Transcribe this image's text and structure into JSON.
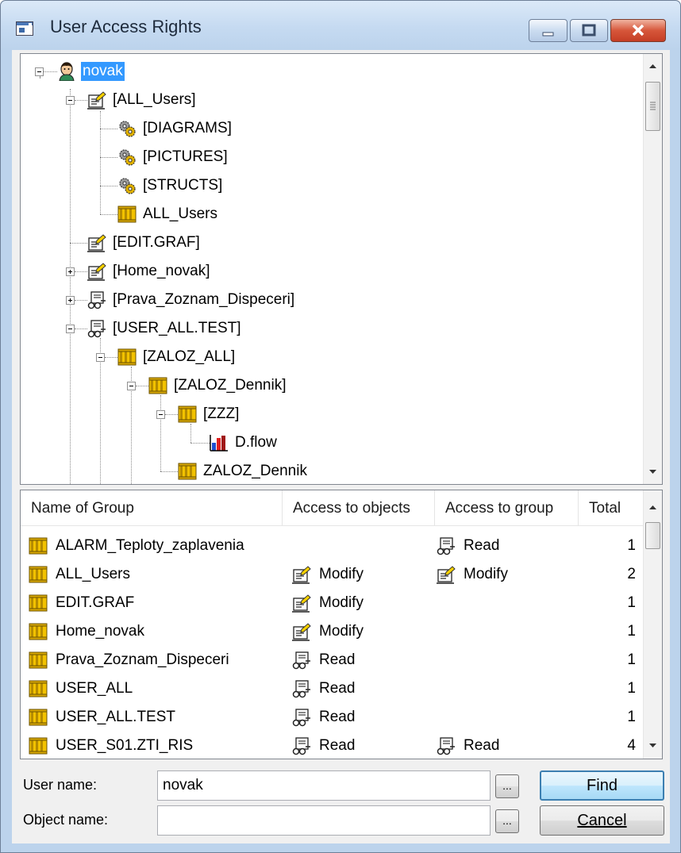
{
  "window": {
    "title": "User Access Rights"
  },
  "tree": {
    "nodes": [
      {
        "label": "novak",
        "icon": "user-icon",
        "selected": true
      },
      {
        "label": "[ALL_Users]",
        "icon": "modify-rights-icon"
      },
      {
        "label": "[DIAGRAMS]",
        "icon": "gears-icon"
      },
      {
        "label": "[PICTURES]",
        "icon": "gears-icon"
      },
      {
        "label": "[STRUCTS]",
        "icon": "gears-icon"
      },
      {
        "label": "ALL_Users",
        "icon": "group-icon"
      },
      {
        "label": "[EDIT.GRAF]",
        "icon": "modify-rights-icon"
      },
      {
        "label": "[Home_novak]",
        "icon": "modify-rights-icon"
      },
      {
        "label": "[Prava_Zoznam_Dispeceri]",
        "icon": "read-rights-icon"
      },
      {
        "label": "[USER_ALL.TEST]",
        "icon": "read-rights-icon"
      },
      {
        "label": "[ZALOZ_ALL]",
        "icon": "group-icon"
      },
      {
        "label": "[ZALOZ_Dennik]",
        "icon": "group-icon"
      },
      {
        "label": "[ZZZ]",
        "icon": "group-icon"
      },
      {
        "label": "D.flow",
        "icon": "diagram-icon"
      },
      {
        "label": "ZALOZ_Dennik",
        "icon": "group-icon"
      }
    ]
  },
  "list": {
    "columns": [
      "Name of Group",
      "Access to objects",
      "Access to group",
      "Total"
    ],
    "rows": [
      {
        "name": "ALARM_Teploty_zaplavenia",
        "obj": "",
        "obj_icon": "",
        "grp": "Read",
        "grp_icon": "read-rights-icon",
        "total": "1"
      },
      {
        "name": "ALL_Users",
        "obj": "Modify",
        "obj_icon": "modify-rights-icon",
        "grp": "Modify",
        "grp_icon": "modify-rights-icon",
        "total": "2"
      },
      {
        "name": "EDIT.GRAF",
        "obj": "Modify",
        "obj_icon": "modify-rights-icon",
        "grp": "",
        "grp_icon": "",
        "total": "1"
      },
      {
        "name": "Home_novak",
        "obj": "Modify",
        "obj_icon": "modify-rights-icon",
        "grp": "",
        "grp_icon": "",
        "total": "1"
      },
      {
        "name": "Prava_Zoznam_Dispeceri",
        "obj": "Read",
        "obj_icon": "read-rights-icon",
        "grp": "",
        "grp_icon": "",
        "total": "1"
      },
      {
        "name": "USER_ALL",
        "obj": "Read",
        "obj_icon": "read-rights-icon",
        "grp": "",
        "grp_icon": "",
        "total": "1"
      },
      {
        "name": "USER_ALL.TEST",
        "obj": "Read",
        "obj_icon": "read-rights-icon",
        "grp": "",
        "grp_icon": "",
        "total": "1"
      },
      {
        "name": "USER_S01.ZTI_RIS",
        "obj": "Read",
        "obj_icon": "read-rights-icon",
        "grp": "Read",
        "grp_icon": "read-rights-icon",
        "total": "4"
      }
    ]
  },
  "form": {
    "user_name_label": "User name:",
    "user_name_value": "novak",
    "object_name_label": "Object name:",
    "object_name_value": "",
    "browse_label": "...",
    "find_label": "Find",
    "cancel_label": "Cancel"
  }
}
